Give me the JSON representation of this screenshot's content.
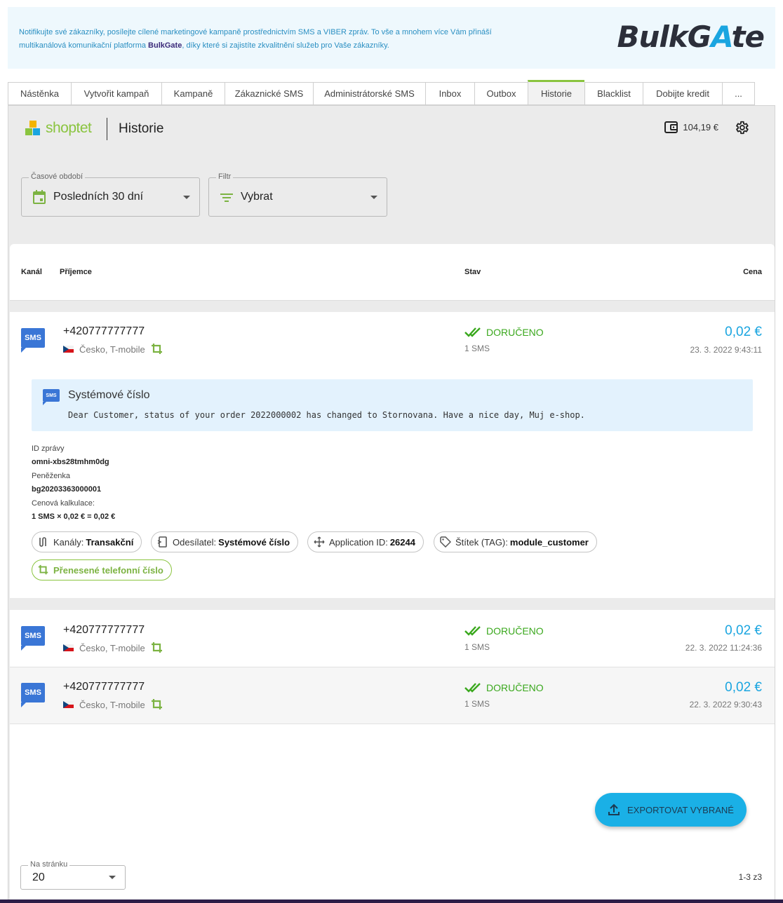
{
  "banner": {
    "text_before": "Notifikujte své zákazníky, posílejte cílené marketingové kampaně prostřednictvím SMS a VIBER zpráv. To vše a mnohem více Vám přináší multikanálová komunikační platforma ",
    "brand": "BulkGate",
    "text_after": ", díky které si zajistíte zkvalitnění služeb pro Vaše zákazníky.",
    "logo_left": "BulkG",
    "logo_highlight": "A",
    "logo_right": "te"
  },
  "tabs": [
    {
      "label": "Nástěnka",
      "active": false
    },
    {
      "label": "Vytvořit kampaň",
      "active": false
    },
    {
      "label": "Kampaně",
      "active": false
    },
    {
      "label": "Zákaznické SMS",
      "active": false
    },
    {
      "label": "Administrátorské SMS",
      "active": false
    },
    {
      "label": "Inbox",
      "active": false
    },
    {
      "label": "Outbox",
      "active": false
    },
    {
      "label": "Historie",
      "active": true
    },
    {
      "label": "Blacklist",
      "active": false
    },
    {
      "label": "Dobijte kredit",
      "active": false
    },
    {
      "label": "...",
      "active": false
    }
  ],
  "header": {
    "brand": "shoptet",
    "title": "Historie",
    "wallet_balance": "104,19 €"
  },
  "filters": {
    "period_label": "Časové období",
    "period_value": "Posledních 30 dní",
    "filter_label": "Filtr",
    "filter_value": "Vybrat"
  },
  "table": {
    "columns": {
      "channel": "Kanál",
      "recipient": "Příjemce",
      "status": "Stav",
      "price": "Cena"
    },
    "rows": [
      {
        "channel": "SMS",
        "phone": "+420777777777",
        "country": "Česko, T-mobile",
        "status": "DORUČENO",
        "count": "1 SMS",
        "price": "0,02 €",
        "date": "23. 3. 2022 9:43:11"
      },
      {
        "channel": "SMS",
        "phone": "+420777777777",
        "country": "Česko, T-mobile",
        "status": "DORUČENO",
        "count": "1 SMS",
        "price": "0,02 €",
        "date": "22. 3. 2022 11:24:36"
      },
      {
        "channel": "SMS",
        "phone": "+420777777777",
        "country": "Česko, T-mobile",
        "status": "DORUČENO",
        "count": "1 SMS",
        "price": "0,02 €",
        "date": "22. 3. 2022 9:30:43"
      }
    ]
  },
  "detail": {
    "badge": "SMS",
    "sender": "Systémové číslo",
    "message": "Dear Customer, status of your order 2022000002 has changed to Stornovana. Have a nice day, Muj e-shop.",
    "message_id_label": "ID zprávy",
    "message_id": "omni-xbs28tmhm0dg",
    "wallet_label": "Peněženka",
    "wallet": "bg20203363000001",
    "calc_label": "Cenová kalkulace:",
    "calc": "1 SMS × 0,02 € = 0,02 €",
    "chips": {
      "channels_label": "Kanály:",
      "channels_value": "Transakční",
      "sender_label": "Odesílatel:",
      "sender_value": "Systémové číslo",
      "app_label": "Application ID:",
      "app_value": "26244",
      "tag_label": "Štítek (TAG):",
      "tag_value": "module_customer",
      "ported": "Přenesené telefonní číslo"
    }
  },
  "footer": {
    "export": "EXPORTOVAT VYBRANÉ",
    "per_page_label": "Na stránku",
    "per_page_value": "20",
    "pagination": "1-3 z3"
  },
  "colors": {
    "accent_green": "#8ac43f",
    "delivered": "#3aa81d",
    "price_blue": "#1aa5e0",
    "export": "#1ab0e6"
  }
}
